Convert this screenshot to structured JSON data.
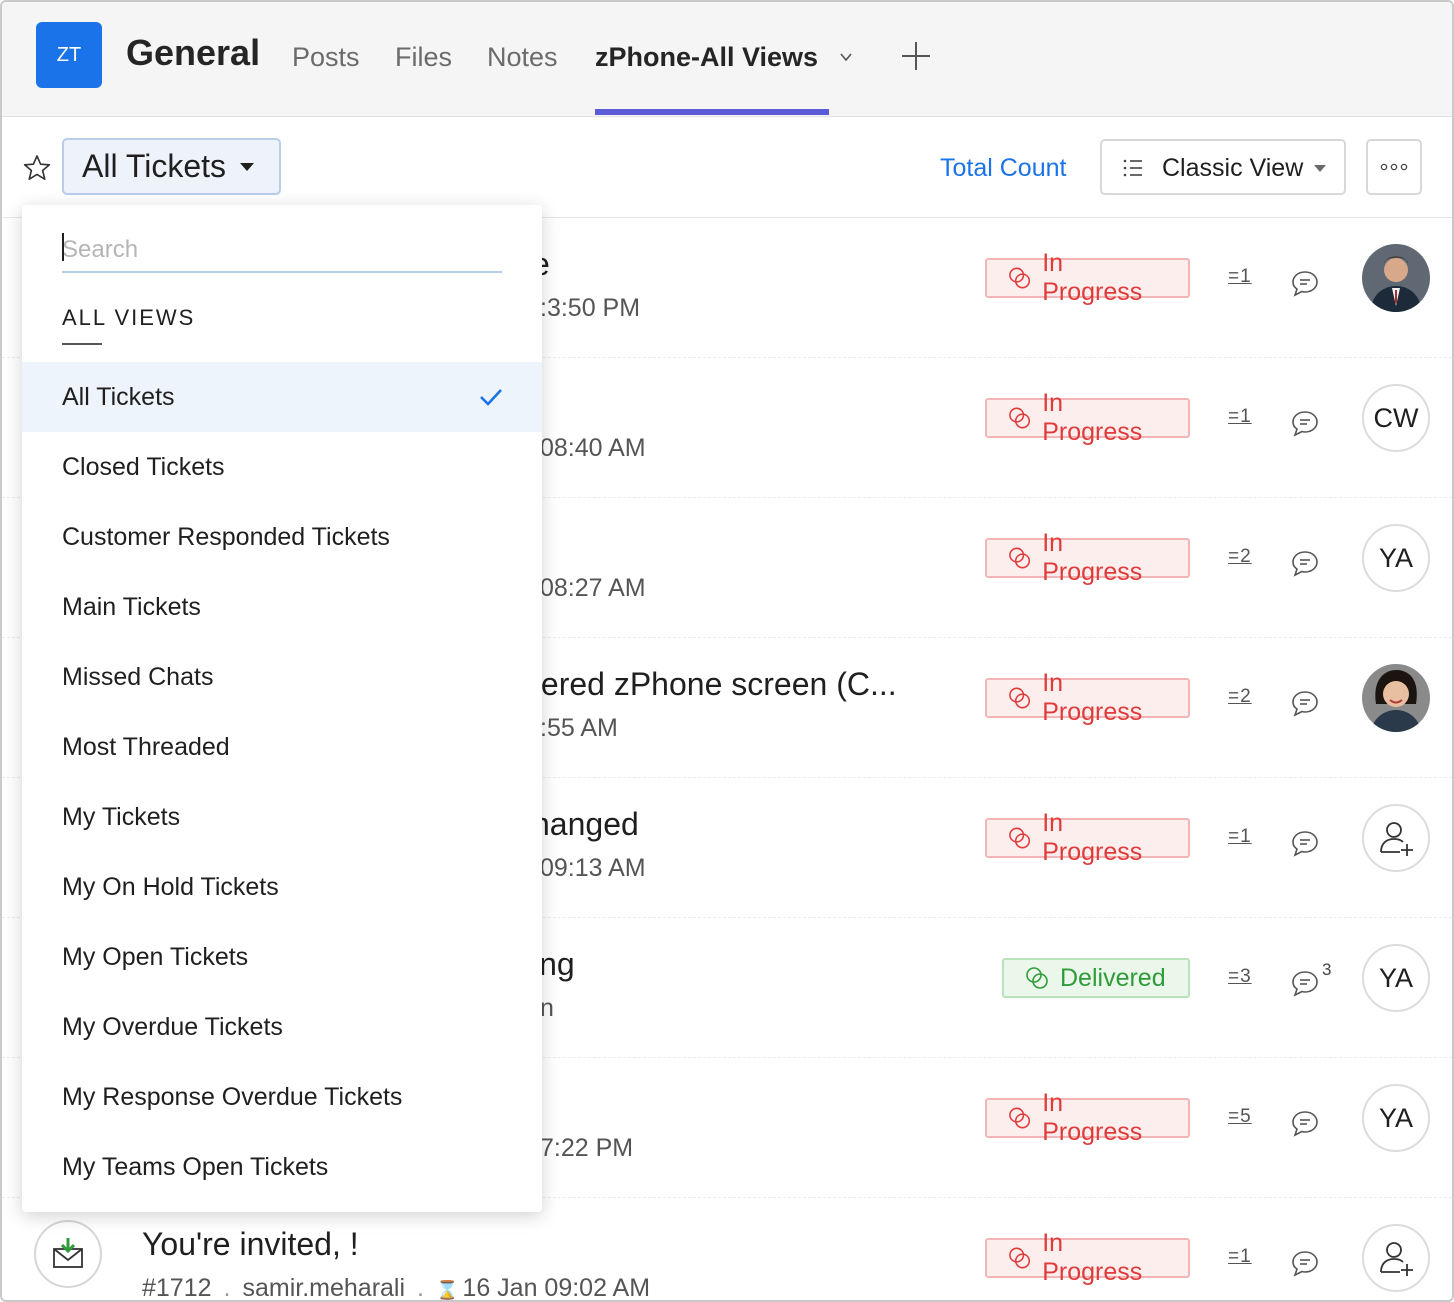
{
  "header": {
    "team_initials": "ZT",
    "team_name": "General",
    "tabs": [
      {
        "label": "Posts"
      },
      {
        "label": "Files"
      },
      {
        "label": "Notes"
      },
      {
        "label": "zPhone-All Views"
      }
    ]
  },
  "toolbar": {
    "view_label": "All Tickets",
    "total_count": "Total Count",
    "layout_label": "Classic View"
  },
  "dropdown": {
    "search_placeholder": "Search",
    "section_title": "ALL VIEWS",
    "items": [
      {
        "label": "All Tickets",
        "selected": true
      },
      {
        "label": "Closed Tickets"
      },
      {
        "label": "Customer Responded Tickets"
      },
      {
        "label": "Main Tickets"
      },
      {
        "label": "Missed Chats"
      },
      {
        "label": "Most Threaded"
      },
      {
        "label": "My Tickets"
      },
      {
        "label": "My On Hold Tickets"
      },
      {
        "label": "My Open Tickets"
      },
      {
        "label": "My Overdue Tickets"
      },
      {
        "label": "My Response Overdue Tickets"
      },
      {
        "label": "My Teams Open Tickets"
      }
    ]
  },
  "tickets": [
    {
      "subject": "e",
      "meta": ":3:50 PM",
      "status": "In Progress",
      "threads": "=1",
      "assignee": "",
      "assignee_type": "photo-man"
    },
    {
      "subject": "",
      "meta": "08:40 AM",
      "status": "In Progress",
      "threads": "=1",
      "assignee": "CW",
      "assignee_type": "initials"
    },
    {
      "subject": "",
      "meta": "08:27 AM",
      "status": "In Progress",
      "threads": "=2",
      "assignee": "YA",
      "assignee_type": "initials"
    },
    {
      "subject": "tered zPhone screen (C...",
      "meta": ":55 AM",
      "status": "In Progress",
      "threads": "=2",
      "assignee": "",
      "assignee_type": "photo-woman"
    },
    {
      "subject": "hanged",
      "meta": "09:13 AM",
      "status": "In Progress",
      "threads": "=1",
      "assignee": "",
      "assignee_type": "add-user-icon"
    },
    {
      "subject": "ing",
      "meta": "n",
      "status": "Delivered",
      "threads": "=3",
      "comments": "3",
      "assignee": "YA",
      "assignee_type": "initials"
    },
    {
      "subject": "",
      "meta": "7:22 PM",
      "status": "In Progress",
      "threads": "=5",
      "assignee": "YA",
      "assignee_type": "initials"
    },
    {
      "subject": "You're invited, !",
      "id": "#1712",
      "requester": "samir.meharali",
      "due": "16 Jan 09:02 AM",
      "status": "In Progress",
      "threads": "=1",
      "assignee": "",
      "assignee_type": "add-user-icon"
    }
  ],
  "colors": {
    "accent": "#1a73e8",
    "tab_underline": "#5b5bd6",
    "in_progress": "#e03b3b",
    "delivered": "#2f9c3a"
  }
}
